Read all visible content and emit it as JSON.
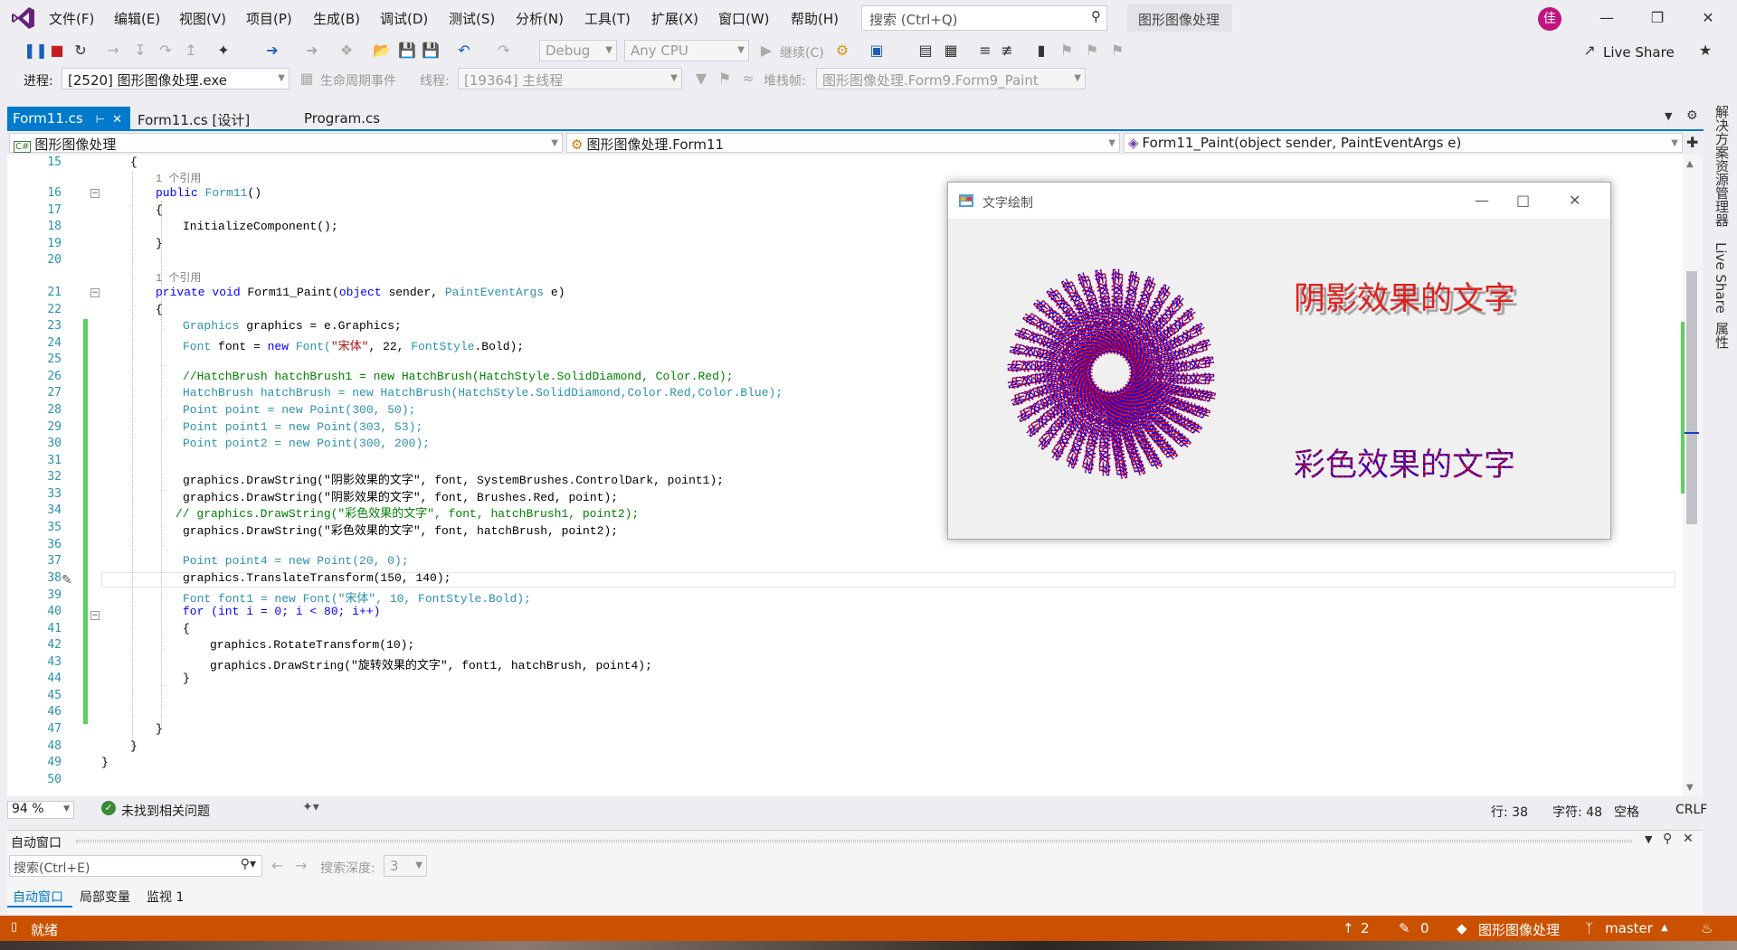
{
  "menu": [
    "文件(F)",
    "编辑(E)",
    "视图(V)",
    "项目(P)",
    "生成(B)",
    "调试(D)",
    "测试(S)",
    "分析(N)",
    "工具(T)",
    "扩展(X)",
    "窗口(W)",
    "帮助(H)"
  ],
  "search": {
    "placeholder": "搜索 (Ctrl+Q)"
  },
  "project_title": "图形图像处理",
  "avatar_initial": "佳",
  "toolbar": {
    "config": "Debug",
    "platform": "Any CPU",
    "continue": "继续(C)",
    "live_share": "Live Share"
  },
  "toolbar2": {
    "process_label": "进程:",
    "process_value": "[2520] 图形图像处理.exe",
    "lifecycle": "生命周期事件",
    "thread_label": "线程:",
    "thread_value": "[19364] 主线程",
    "stack_label": "堆栈帧:",
    "stack_value": "图形图像处理.Form9.Form9_Paint"
  },
  "tabs": [
    {
      "label": "Form11.cs",
      "active": true
    },
    {
      "label": "Form11.cs [设计]",
      "active": false
    },
    {
      "label": "Program.cs",
      "active": false
    }
  ],
  "nav": {
    "project": "图形图像处理",
    "class": "图形图像处理.Form11",
    "member": "Form11_Paint(object sender, PaintEventArgs e)"
  },
  "line_numbers": [
    "15",
    "16",
    "17",
    "18",
    "19",
    "20",
    "21",
    "22",
    "23",
    "24",
    "25",
    "26",
    "27",
    "28",
    "29",
    "30",
    "31",
    "32",
    "33",
    "34",
    "35",
    "36",
    "37",
    "38",
    "39",
    "40",
    "41",
    "42",
    "43",
    "44",
    "45",
    "46",
    "47",
    "48",
    "49",
    "50"
  ],
  "code": {
    "l15": "{",
    "ref1": "1 个引用",
    "l16_kw": "public ",
    "l16_ty": "Form11",
    "l16_rest": "()",
    "l17": "{",
    "l18": "InitializeComponent();",
    "l19": "}",
    "ref2": "1 个引用",
    "l21_kw": "private void ",
    "l21_name": "Form11_Paint(",
    "l21_kw2": "object ",
    "l21_p": "sender, ",
    "l21_ty": "PaintEventArgs ",
    "l21_e": "e)",
    "l22": "{",
    "l23_ty": "Graphics ",
    "l23_rest": "graphics = e.Graphics;",
    "l24_ty": "Font ",
    "l24_a": "font = ",
    "l24_kw": "new ",
    "l24_ty2": "Font(",
    "l24_st": "\"宋体\"",
    "l24_b": ", 22, ",
    "l24_ty3": "FontStyle",
    "l24_c": ".Bold);",
    "l26": "//HatchBrush hatchBrush1 = new HatchBrush(HatchStyle.SolidDiamond, Color.Red);",
    "l27": "HatchBrush hatchBrush = new HatchBrush(HatchStyle.SolidDiamond,Color.Red,Color.Blue);",
    "l28": "Point point = new Point(300, 50);",
    "l29": "Point point1 = new Point(303, 53);",
    "l30": "Point point2 = new Point(300, 200);",
    "l32": "graphics.DrawString(\"阴影效果的文字\", font, SystemBrushes.ControlDark, point1);",
    "l33": "graphics.DrawString(\"阴影效果的文字\", font, Brushes.Red, point);",
    "l34": "// graphics.DrawString(\"彩色效果的文字\", font, hatchBrush1, point2);",
    "l35": "graphics.DrawString(\"彩色效果的文字\", font, hatchBrush, point2);",
    "l37": "Point point4 = new Point(20, 0);",
    "l38": "graphics.TranslateTransform(150, 140);",
    "l39": "Font font1 = new Font(\"宋体\", 10, FontStyle.Bold);",
    "l40": "for (int i = 0; i < 80; i++)",
    "l41": "{",
    "l42": "graphics.RotateTransform(10);",
    "l43": "graphics.DrawString(\"旋转效果的文字\", font1, hatchBrush, point4);",
    "l44": "}",
    "l47": "}",
    "l48": "}",
    "l49": "}"
  },
  "form": {
    "title": "文字绘制",
    "shadow_text": "阴影效果的文字",
    "color_text": "彩色效果的文字",
    "rotated_text": "旋转效果的文字",
    "rotation_step_deg": 10,
    "rotation_count": 80
  },
  "editor_status": {
    "zoom": "94 %",
    "issues": "未找到相关问题",
    "line": "行: 38",
    "char": "字符: 48",
    "spaces": "空格",
    "eol": "CRLF"
  },
  "autos": {
    "title": "自动窗口",
    "search_placeholder": "搜索(Ctrl+E)",
    "depth_label": "搜索深度:",
    "depth_value": "3",
    "tabs": [
      "自动窗口",
      "局部变量",
      "监视 1"
    ]
  },
  "right_panel": [
    "解决方案资源管理器",
    "Live Share",
    "属性"
  ],
  "statusbar": {
    "ready": "就绪",
    "up": "2",
    "pencil": "0",
    "repo": "图形图像处理",
    "branch": "master"
  },
  "colors": {
    "accent": "#007acc",
    "status": "#ca5100",
    "keyword": "#0000ff",
    "type": "#2b91af",
    "string": "#a31515",
    "comment": "#008000"
  }
}
